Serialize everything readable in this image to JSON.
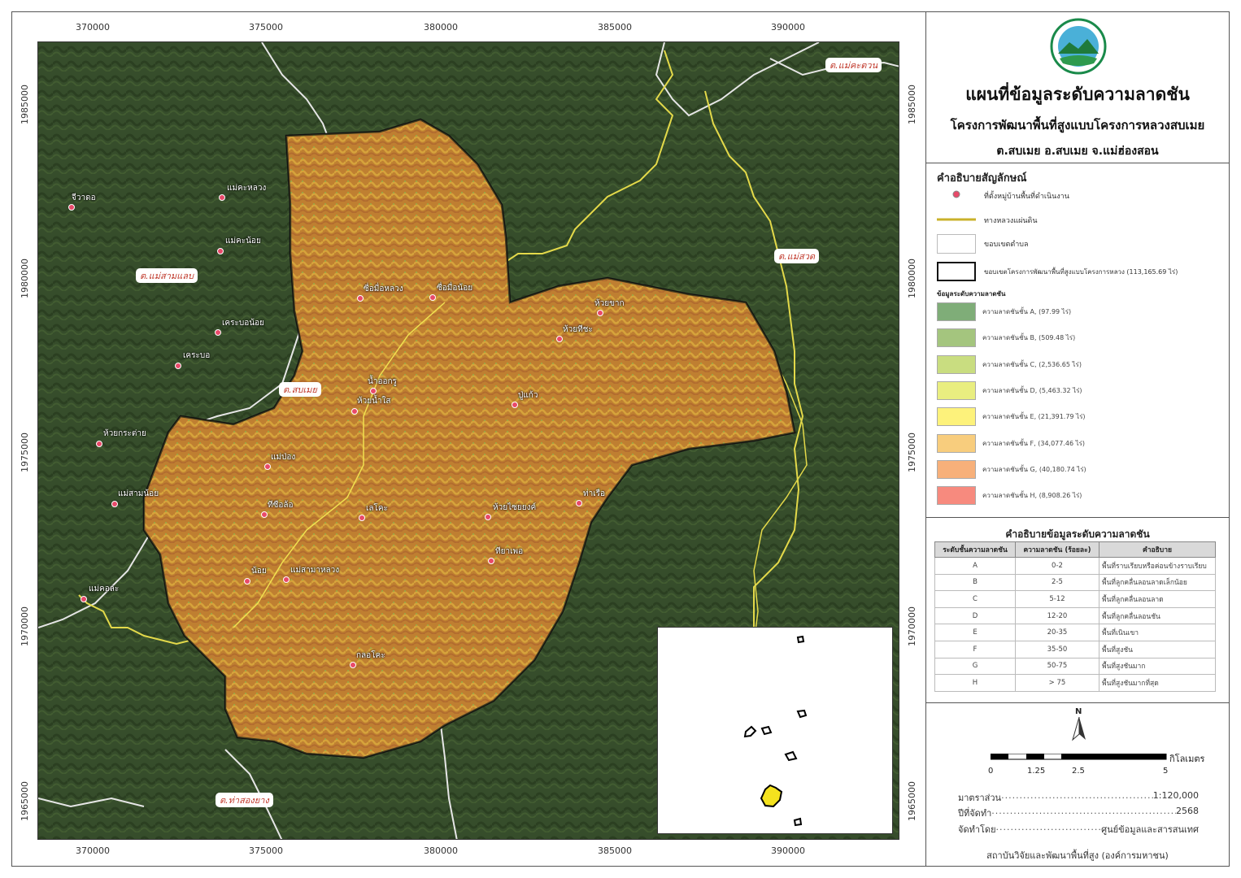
{
  "title": {
    "main": "แผนที่ข้อมูลระดับความลาดชัน",
    "sub1": "โครงการพัฒนาพื้นที่สูงแบบโครงการหลวงสบเมย",
    "sub2": "ต.สบเมย อ.สบเมย จ.แม่ฮ่องสอน"
  },
  "axes": {
    "x_ticks": [
      "370000",
      "375000",
      "380000",
      "385000",
      "390000"
    ],
    "y_ticks": [
      "1985000",
      "1980000",
      "1975000",
      "1970000",
      "1965000"
    ]
  },
  "tambon_labels": [
    "ต.แม่คะตวน",
    "ต.แม่สามแลบ",
    "ต.แม่สวด",
    "ต.สบเมย",
    "ต.ท่าสองยาง"
  ],
  "villages": [
    "จีวาดอ",
    "แม่คะหลวง",
    "แม่คะน้อย",
    "เคระบอน้อย",
    "เคระบอ",
    "ห้วยกระต่าย",
    "แม่สามน้อย",
    "แม่คอละ",
    "ซื่อมื่อหลวง",
    "ซื่อมื่อน้อย",
    "ห้วยขาก",
    "ห้วยทีชะ",
    "น้ำออกรู",
    "ห้วยน้ำใส",
    "ปู่แก้ว",
    "แม่ป่อง",
    "ทีซือล้อ",
    "เลโคะ",
    "ห้วยไซยยงค์",
    "ท่าเรือ",
    "ทียาเพอ",
    "น้อย",
    "แม่สามาหลวง",
    "กลอโคะ"
  ],
  "legend": {
    "title": "คำอธิบายสัญลักษณ์",
    "village": "ที่ตั้งหมู่บ้านพื้นที่ดำเนินงาน",
    "road": "ทางหลวงแผ่นดิน",
    "subdistrict": "ขอบเขตตำบล",
    "project": "ขอบเขตโครงการพัฒนาพื้นที่สูงแบบโครงการหลวง (113,165.69 ไร่)",
    "slope_title": "ข้อมูลระดับความลาดชัน",
    "classes": [
      {
        "label": "ความลาดชันชั้น A, (97.99 ไร่)",
        "color": "#7fad78"
      },
      {
        "label": "ความลาดชันชั้น B, (509.48 ไร่)",
        "color": "#a4c57e"
      },
      {
        "label": "ความลาดชันชั้น C, (2,536.65 ไร่)",
        "color": "#c9dd80"
      },
      {
        "label": "ความลาดชันชั้น D, (5,463.32 ไร่)",
        "color": "#e9ee80"
      },
      {
        "label": "ความลาดชันชั้น E, (21,391.79 ไร่)",
        "color": "#fdf27b"
      },
      {
        "label": "ความลาดชันชั้น F, (34,077.46 ไร่)",
        "color": "#f8cd7d"
      },
      {
        "label": "ความลาดชันชั้น G, (40,180.74 ไร่)",
        "color": "#f7b07a"
      },
      {
        "label": "ความลาดชันชั้น H, (8,908.26 ไร่)",
        "color": "#f78a7e"
      }
    ]
  },
  "slope_table": {
    "title": "คำอธิบายข้อมูลระดับความลาดชัน",
    "headers": [
      "ระดับชั้นความลาดชัน",
      "ความลาดชัน (ร้อยละ)",
      "คำอธิบาย"
    ],
    "rows": [
      [
        "A",
        "0-2",
        "พื้นที่ราบเรียบหรือค่อนข้างราบเรียบ"
      ],
      [
        "B",
        "2-5",
        "พื้นที่ลูกคลื่นลอนลาดเล็กน้อย"
      ],
      [
        "C",
        "5-12",
        "พื้นที่ลูกคลื่นลอนลาด"
      ],
      [
        "D",
        "12-20",
        "พื้นที่ลูกคลื่นลอนชัน"
      ],
      [
        "E",
        "20-35",
        "พื้นที่เนินเขา"
      ],
      [
        "F",
        "35-50",
        "พื้นที่สูงชัน"
      ],
      [
        "G",
        "50-75",
        "พื้นที่สูงชันมาก"
      ],
      [
        "H",
        "> 75",
        "พื้นที่สูงชันมากที่สุด"
      ]
    ]
  },
  "scalebar": {
    "north": "N",
    "unit": "กิโลเมตร",
    "ticks": [
      "0",
      "1.25",
      "2.5",
      "5"
    ]
  },
  "info": {
    "scale_label": "มาตราส่วน",
    "scale_value": "1:120,000",
    "year_label": "ปีที่จัดทำ",
    "year_value": "2568",
    "by_label": "จัดทำโดย",
    "by_value": "ศูนย์ข้อมูลและสารสนเทศ",
    "dots": "..............................................................................................................."
  },
  "footer": "สถาบันวิจัยและพัฒนาพื้นที่สูง (องค์การมหาชน)"
}
